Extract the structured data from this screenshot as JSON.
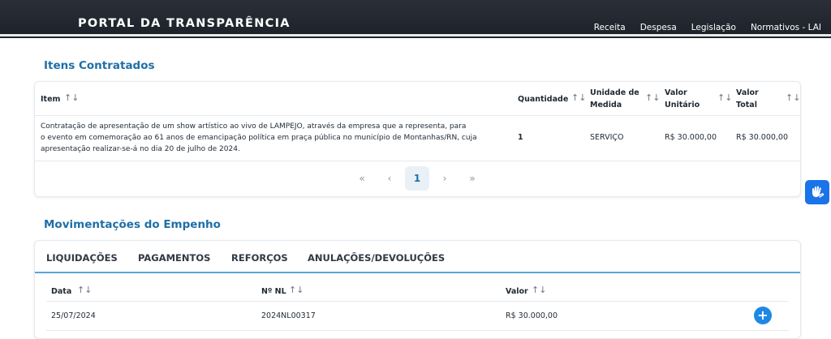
{
  "header": {
    "brand": "PORTAL DA TRANSPARÊNCIA",
    "nav": [
      "Receita",
      "Despesa",
      "Legislação",
      "Normativos - LAI"
    ]
  },
  "items_section": {
    "title": "Itens Contratados",
    "columns": {
      "item": "Item",
      "quantidade": "Quantidade",
      "unidade_l1": "Unidade de",
      "unidade_l2": "Medida",
      "unitario_l1": "Valor",
      "unitario_l2": "Unitário",
      "total_l1": "Valor",
      "total_l2": "Total"
    },
    "row": {
      "description_lines": [
        "Contratação de apresentação de um show artístico ao vivo de LAMPEJO, através da empresa que a representa, para",
        "o evento em comemoração ao 61 anos de emancipação política em praça pública no município de Montanhas/RN, cuja",
        "apresentação realizar-se-á no dia 20 de julho de 2024."
      ],
      "quantidade": "1",
      "unidade": "SERVIÇO",
      "valor_unitario": "R$ 30.000,00",
      "valor_total": "R$ 30.000,00"
    },
    "pagination": {
      "first": "«",
      "prev": "‹",
      "current": "1",
      "next": "›",
      "last": "»"
    }
  },
  "movements_section": {
    "title": "Movimentações do Empenho",
    "tabs": [
      "LIQUIDAÇÕES",
      "PAGAMENTOS",
      "REFORÇOS",
      "ANULAÇÕES/DEVOLUÇÕES"
    ],
    "columns": {
      "data": "Data",
      "nl": "Nº NL",
      "valor": "Valor"
    },
    "row": {
      "data": "25/07/2024",
      "nl": "2024NL00317",
      "valor": "R$ 30.000,00",
      "expand": "+"
    }
  },
  "sort_glyph": "↑↓",
  "colors": {
    "accent": "#1f6fa8",
    "header_bg": "#1d222a",
    "plus_button": "#1e88e5",
    "accessibility": "#1a73e8"
  }
}
